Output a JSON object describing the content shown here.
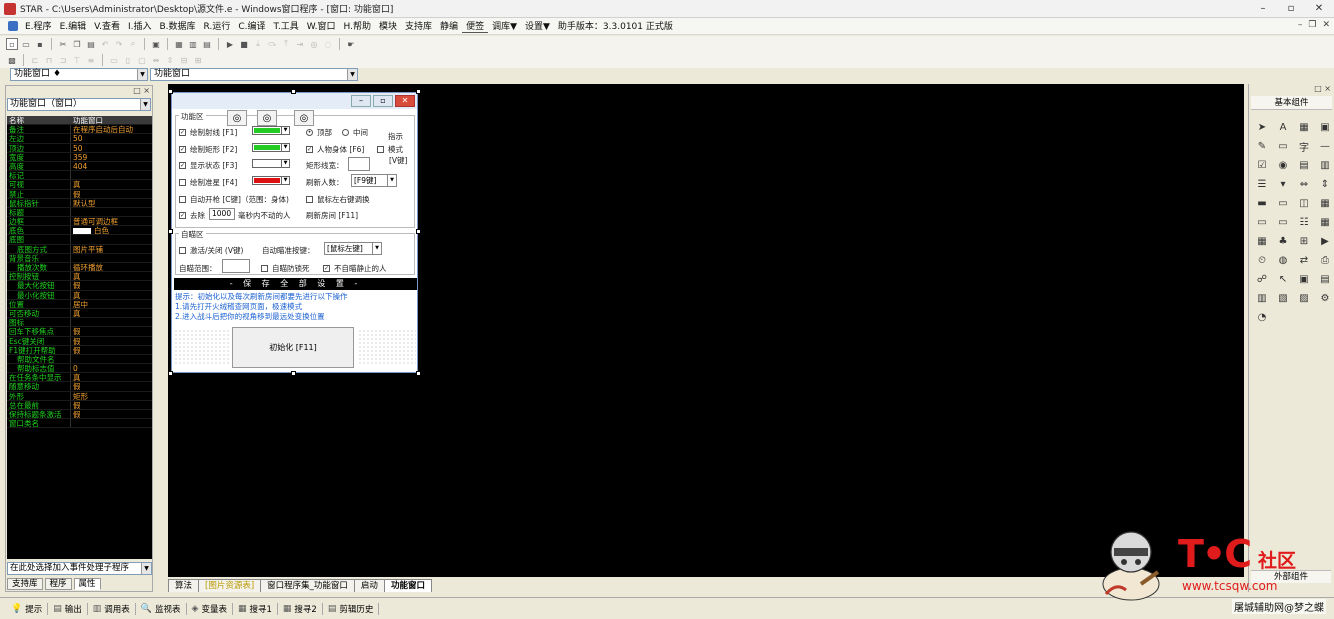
{
  "window": {
    "title": "STAR - C:\\Users\\Administrator\\Desktop\\源文件.e - Windows窗口程序 - [窗口: 功能窗口]",
    "controls": [
      "–",
      "▫",
      "✕"
    ]
  },
  "menu": {
    "items": [
      "E.程序",
      "E.编辑",
      "V.查看",
      "I.插入",
      "B.数据库",
      "R.运行",
      "C.编译",
      "T.工具",
      "W.窗口",
      "H.帮助",
      "模块",
      "支持库",
      "静编",
      "便签",
      "调库▼",
      "设置▼",
      "助手版本：3.3.0101 正式版"
    ],
    "selected_index": 13,
    "right_controls": [
      "–",
      "❐",
      "✕"
    ]
  },
  "combos": {
    "object": "功能窗口",
    "event": "功能窗口"
  },
  "props_panel": {
    "header_controls": "□ ×",
    "selector": "功能窗口（窗口）",
    "rows": [
      {
        "k": "名称",
        "v": "功能窗口",
        "hl": true
      },
      {
        "k": "备注",
        "v": "在程序启动后自动"
      },
      {
        "k": "左边",
        "v": "50"
      },
      {
        "k": "顶边",
        "v": "50"
      },
      {
        "k": "宽度",
        "v": "359"
      },
      {
        "k": "高度",
        "v": "404"
      },
      {
        "k": "标记",
        "v": ""
      },
      {
        "k": "可视",
        "v": "真"
      },
      {
        "k": "禁止",
        "v": "假"
      },
      {
        "k": "鼠标指针",
        "v": "默认型"
      },
      {
        "k": "标题",
        "v": ""
      },
      {
        "k": "边框",
        "v": "普通可调边框"
      },
      {
        "k": "底色",
        "v": "白色",
        "swatch": true
      },
      {
        "k": "底图",
        "v": ""
      },
      {
        "k": "底图方式",
        "v": "图片平铺",
        "sub": true
      },
      {
        "k": "背景音乐",
        "v": ""
      },
      {
        "k": "播放次数",
        "v": "循环播放",
        "sub": true
      },
      {
        "k": "控制按钮",
        "v": "真"
      },
      {
        "k": "最大化按钮",
        "v": "假",
        "sub": true
      },
      {
        "k": "最小化按钮",
        "v": "真",
        "sub": true
      },
      {
        "k": "位置",
        "v": "居中"
      },
      {
        "k": "可否移动",
        "v": "真"
      },
      {
        "k": "图标",
        "v": ""
      },
      {
        "k": "回车下移焦点",
        "v": "假"
      },
      {
        "k": "Esc键关闭",
        "v": "假"
      },
      {
        "k": "F1键打开帮助",
        "v": "假"
      },
      {
        "k": "帮助文件名",
        "v": "",
        "sub": true
      },
      {
        "k": "帮助标志值",
        "v": "0",
        "sub": true
      },
      {
        "k": "在任务条中显示",
        "v": "真"
      },
      {
        "k": "随意移动",
        "v": "假"
      },
      {
        "k": "外形",
        "v": "矩形"
      },
      {
        "k": "总在最前",
        "v": "假"
      },
      {
        "k": "保持标题条激活",
        "v": "假"
      },
      {
        "k": "窗口类名",
        "v": ""
      }
    ],
    "event_placeholder": "在此处选择加入事件处理子程序",
    "tabs": [
      "支持库",
      "程序",
      "属性"
    ],
    "active_tab": 2
  },
  "form": {
    "group1_label": "功能区",
    "group2_label": "自瞄区",
    "chk_draw_ray": "绘制射线 [F1]",
    "chk_draw_rect": "绘制矩形 [F2]",
    "chk_show_status": "显示状态 [F3]",
    "chk_draw_crosshair": "绘制准星 [F4]",
    "chk_auto_fire": "自动开枪 [C键]（范围：身体)",
    "chk_remove": "去除",
    "remove_value": "1000",
    "remove_suffix": "毫秒内不动的人",
    "radio_top": "顶部",
    "radio_middle": "中间",
    "side_label": "指示",
    "chk_body": "人物身体 [F6]",
    "chk_mode": "模式",
    "mode_key": "[V键]",
    "rect_width_label": "矩形线宽：",
    "refresh_people_label": "刷新人数：",
    "refresh_people_value": "[F9键]",
    "chk_mouse_switch": "鼠标左右键调换",
    "refresh_room": "刷新房间 [F11]",
    "chk_activate": "激活/关闭 (V键)",
    "aim_key_label": "自动瞄准按键：",
    "aim_key_value": "[鼠标左键]",
    "aim_range_label": "自瞄范围：",
    "chk_aim_prevent": "自瞄防锁死",
    "chk_aim_static": "不自瞄静止的人",
    "save_all": "- 保 存 全 部 设 置 -",
    "tips": [
      "提示：初始化以及每次刷新房间都要先进行以下操作",
      "1.请先打开火绒稽查网页面，极速模式",
      "2.进入战斗后把你的视角移到最远处变换位置"
    ],
    "init_button": "初始化 [F11]",
    "colors": {
      "draw_ray": "#22cc22",
      "draw_rect": "#22cc22",
      "show_status": "#ffffff",
      "crosshair": "#dd1111"
    }
  },
  "toolbox": {
    "header_controls": "□ ×",
    "title": "基本组件",
    "footer": "外部组件",
    "icons": [
      "pointer-icon",
      "label-icon",
      "image-icon",
      "picture-icon",
      "edit-icon",
      "frame-icon",
      "text-icon",
      "line-icon",
      "checkbox-icon",
      "radio-icon",
      "groupbox-icon",
      "panel-icon",
      "listbox-icon",
      "combobox-icon",
      "hscroll-icon",
      "vscroll-icon",
      "tab-icon",
      "bar-icon",
      "split-icon",
      "grid-icon",
      "button-icon",
      "field-icon",
      "list-icon",
      "chart-icon",
      "table-icon",
      "tree-icon",
      "page-icon",
      "media-icon",
      "timer-icon",
      "db-icon",
      "socket-icon",
      "printer-icon",
      "link-icon",
      "cursor-icon",
      "window-icon",
      "browser-icon",
      "report-icon",
      "form-icon",
      "calendar-icon",
      "settings-icon",
      "clock-icon"
    ],
    "glyphs": [
      "➤",
      "A",
      "▦",
      "▣",
      "✎",
      "▭",
      "字",
      "—",
      "☑",
      "◉",
      "▤",
      "▥",
      "☰",
      "▾",
      "⇔",
      "⇕",
      "▬",
      "▭",
      "◫",
      "▦",
      "▭",
      "▭",
      "☷",
      "▦",
      "▦",
      "♣",
      "⊞",
      "▶",
      "⏲",
      "◍",
      "⇄",
      "⎙",
      "☍",
      "↖",
      "▣",
      "▤",
      "▥",
      "▧",
      "▨",
      "⚙",
      "◔"
    ]
  },
  "bottom_tabs": [
    {
      "label": "算法",
      "style": ""
    },
    {
      "label": "[图片资源表]",
      "style": "yel"
    },
    {
      "label": "窗口程序集_功能窗口",
      "style": ""
    },
    {
      "label": "启动",
      "style": ""
    },
    {
      "label": "功能窗口",
      "style": "act"
    }
  ],
  "status_bar": [
    {
      "icon": "💡",
      "label": "提示",
      "name": "hint"
    },
    {
      "icon": "▤",
      "label": "输出",
      "name": "output"
    },
    {
      "icon": "▥",
      "label": "调用表",
      "name": "call-table"
    },
    {
      "icon": "🔍",
      "label": "监视表",
      "name": "watch-table"
    },
    {
      "icon": "◈",
      "label": "变量表",
      "name": "variable-table"
    },
    {
      "icon": "▦",
      "label": "搜寻1",
      "name": "search1"
    },
    {
      "icon": "▦",
      "label": "搜寻2",
      "name": "search2"
    },
    {
      "icon": "▤",
      "label": "剪辑历史",
      "name": "clip-history"
    }
  ],
  "watermark": {
    "logo": "T•C",
    "logo_text": "社区",
    "url": "www.tcsqw.com",
    "signature": "屠城辅助网@梦之蝶"
  }
}
